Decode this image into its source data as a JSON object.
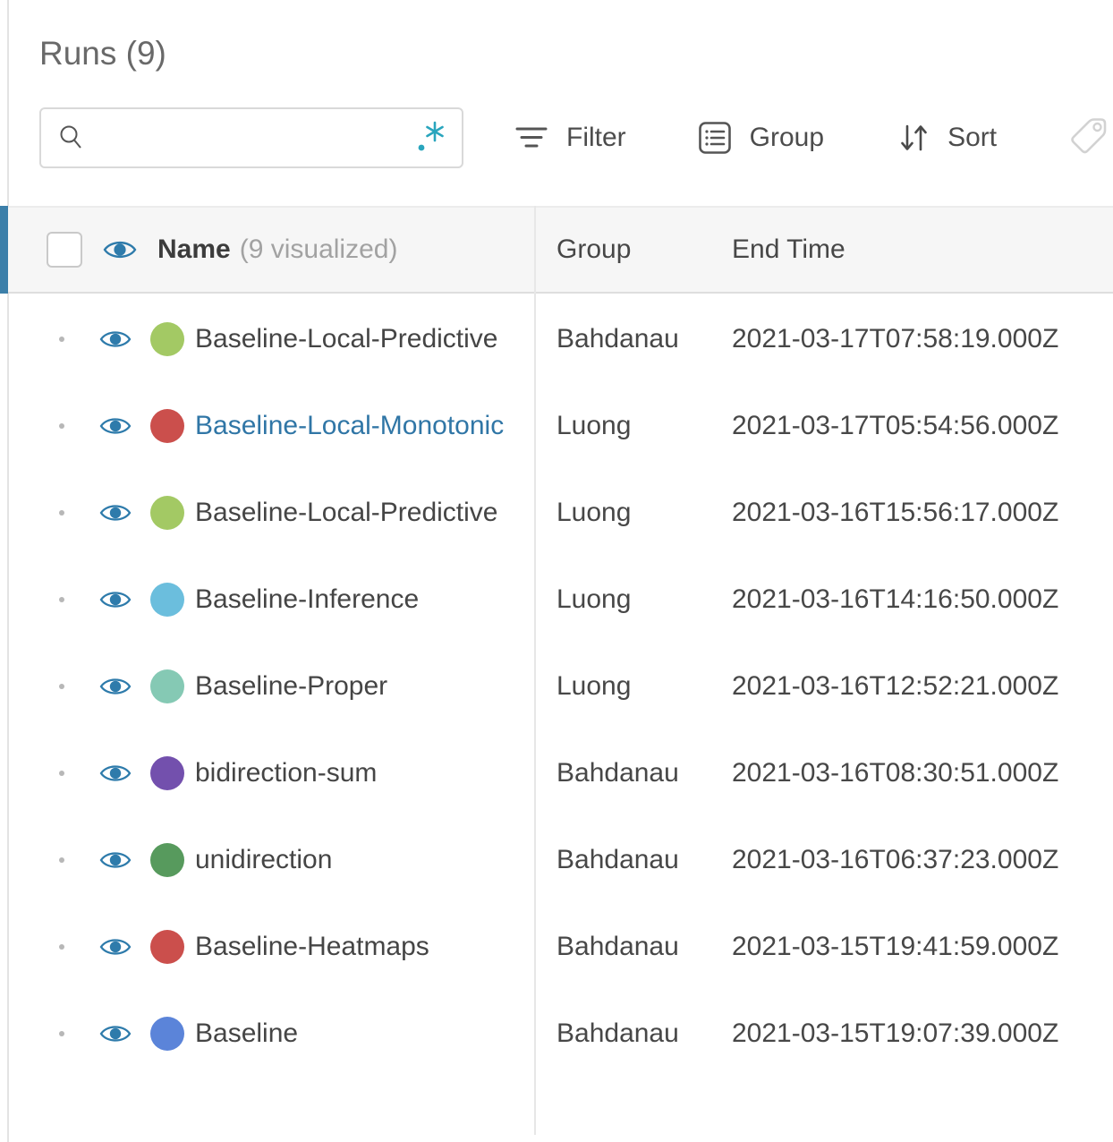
{
  "page": {
    "title": "Runs (9)"
  },
  "search": {
    "value": "",
    "placeholder": ""
  },
  "toolbar": {
    "filter_label": "Filter",
    "group_label": "Group",
    "sort_label": "Sort"
  },
  "table": {
    "name_header": "Name",
    "name_header_suffix": "(9 visualized)",
    "group_header": "Group",
    "end_time_header": "End Time",
    "rows": [
      {
        "name": "Baseline-Local-Predictive",
        "color": "#a3c964",
        "highlighted": false,
        "group": "Bahdanau",
        "end_time": "2021-03-17T07:58:19.000Z"
      },
      {
        "name": "Baseline-Local-Monotonic",
        "color": "#cb4f4c",
        "highlighted": true,
        "group": "Luong",
        "end_time": "2021-03-17T05:54:56.000Z"
      },
      {
        "name": "Baseline-Local-Predictive",
        "color": "#a3c964",
        "highlighted": false,
        "group": "Luong",
        "end_time": "2021-03-16T15:56:17.000Z"
      },
      {
        "name": "Baseline-Inference",
        "color": "#6bbedd",
        "highlighted": false,
        "group": "Luong",
        "end_time": "2021-03-16T14:16:50.000Z"
      },
      {
        "name": "Baseline-Proper",
        "color": "#85c9b4",
        "highlighted": false,
        "group": "Luong",
        "end_time": "2021-03-16T12:52:21.000Z"
      },
      {
        "name": "bidirection-sum",
        "color": "#7350ad",
        "highlighted": false,
        "group": "Bahdanau",
        "end_time": "2021-03-16T08:30:51.000Z"
      },
      {
        "name": "unidirection",
        "color": "#579a5d",
        "highlighted": false,
        "group": "Bahdanau",
        "end_time": "2021-03-16T06:37:23.000Z"
      },
      {
        "name": "Baseline-Heatmaps",
        "color": "#cb4f4c",
        "highlighted": false,
        "group": "Bahdanau",
        "end_time": "2021-03-15T19:41:59.000Z"
      },
      {
        "name": "Baseline",
        "color": "#5b84d9",
        "highlighted": false,
        "group": "Bahdanau",
        "end_time": "2021-03-15T19:07:39.000Z"
      }
    ]
  },
  "colors": {
    "accent_bar_blue": "#3c7fa9",
    "eye_icon_blue": "#2e7bab",
    "highlighted_name_blue": "#3076a6",
    "regex_icon_teal": "#29a5bd",
    "header_background": "#f6f6f6"
  }
}
